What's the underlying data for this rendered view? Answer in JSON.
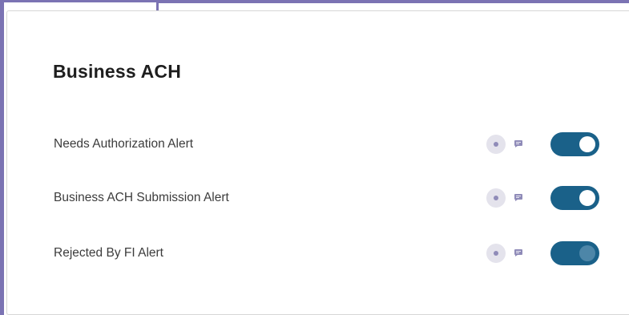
{
  "section": {
    "title": "Business ACH"
  },
  "alerts": [
    {
      "label": "Needs Authorization Alert",
      "email_icon": "email-icon",
      "sms_icon": "sms-icon",
      "enabled": true
    },
    {
      "label": "Business ACH Submission Alert",
      "email_icon": "email-icon",
      "sms_icon": "sms-icon",
      "enabled": true
    },
    {
      "label": "Rejected By FI Alert",
      "email_icon": "email-icon",
      "sms_icon": "sms-icon",
      "enabled": true
    }
  ],
  "colors": {
    "frame": "#7b73b3",
    "toggle_on": "#1a6189",
    "icon_circle": "#e4e3ec",
    "icon_glyph": "#8f8bb8",
    "title_text": "#1e1e1e",
    "label_text": "#3c3c3c"
  }
}
